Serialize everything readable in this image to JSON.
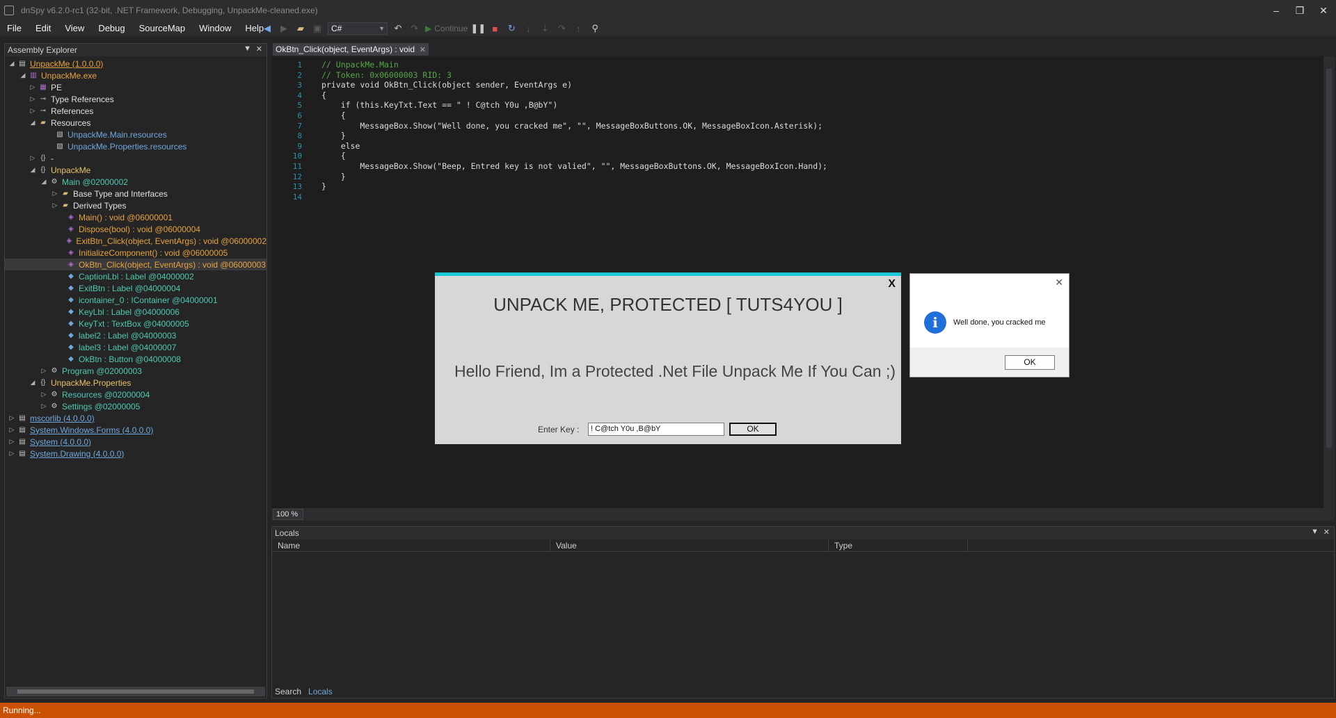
{
  "window": {
    "title": "dnSpy v6.2.0-rc1 (32-bit, .NET Framework, Debugging, UnpackMe-cleaned.exe)",
    "min": "–",
    "max": "❐",
    "close": "✕"
  },
  "menu": [
    "File",
    "Edit",
    "View",
    "Debug",
    "SourceMap",
    "Window",
    "Help"
  ],
  "toolbar": {
    "language": "C#",
    "continue_label": "Continue"
  },
  "explorer": {
    "title": "Assembly Explorer",
    "nodes": [
      {
        "text": "UnpackMe (1.0.0.0)",
        "exp": "◢",
        "icon": "assembly-icon",
        "color": "#e8a33d",
        "u": true
      },
      {
        "text": "UnpackMe.exe",
        "exp": "◢",
        "icon": "module-icon",
        "color": "#e8a33d"
      },
      {
        "text": "PE",
        "exp": "▷",
        "icon": "pe-icon",
        "color": "#e0e0e0"
      },
      {
        "text": "Type References",
        "exp": "▷",
        "icon": "type-ref-icon",
        "color": "#e0e0e0"
      },
      {
        "text": "References",
        "exp": "▷",
        "icon": "references-icon",
        "color": "#e0e0e0"
      },
      {
        "text": "Resources",
        "exp": "◢",
        "icon": "folder-open-icon",
        "color": "#e0e0e0"
      },
      {
        "text": "UnpackMe.Main.resources",
        "exp": "",
        "icon": "resource-icon",
        "color": "#6fa8dc"
      },
      {
        "text": "UnpackMe.Properties.resources",
        "exp": "",
        "icon": "resource-icon",
        "color": "#6fa8dc"
      },
      {
        "text": "-",
        "exp": "▷",
        "icon": "namespace-icon",
        "color": "#e0e0e0"
      },
      {
        "text": "UnpackMe",
        "exp": "◢",
        "icon": "namespace-icon",
        "color": "#e8c36a"
      },
      {
        "text": "Main @02000002",
        "exp": "◢",
        "icon": "class-icon",
        "color": "#4ec9b0"
      },
      {
        "text": "Base Type and Interfaces",
        "exp": "▷",
        "icon": "folder-icon",
        "color": "#e0e0e0"
      },
      {
        "text": "Derived Types",
        "exp": "▷",
        "icon": "folder-icon",
        "color": "#e0e0e0"
      },
      {
        "text": "Main() : void @06000001",
        "exp": "",
        "icon": "method-icon",
        "color": "#e8a33d"
      },
      {
        "text": "Dispose(bool) : void @06000004",
        "exp": "",
        "icon": "method-icon",
        "color": "#e8a33d"
      },
      {
        "text": "ExitBtn_Click(object, EventArgs) : void @06000002",
        "exp": "",
        "icon": "method-icon",
        "color": "#e8a33d"
      },
      {
        "text": "InitializeComponent() : void @06000005",
        "exp": "",
        "icon": "method-icon",
        "color": "#e8a33d"
      },
      {
        "text": "OkBtn_Click(object, EventArgs) : void @06000003",
        "exp": "",
        "icon": "method-icon",
        "color": "#e8a33d",
        "sel": true
      },
      {
        "text": "CaptionLbl : Label @04000002",
        "exp": "",
        "icon": "field-icon",
        "color": "#4ec9b0"
      },
      {
        "text": "ExitBtn : Label @04000004",
        "exp": "",
        "icon": "field-icon",
        "color": "#4ec9b0"
      },
      {
        "text": "icontainer_0 : IContainer @04000001",
        "exp": "",
        "icon": "field-icon",
        "color": "#4ec9b0"
      },
      {
        "text": "KeyLbl : Label @04000006",
        "exp": "",
        "icon": "field-icon",
        "color": "#4ec9b0"
      },
      {
        "text": "KeyTxt : TextBox @04000005",
        "exp": "",
        "icon": "field-icon",
        "color": "#4ec9b0"
      },
      {
        "text": "label2 : Label @04000003",
        "exp": "",
        "icon": "field-icon",
        "color": "#4ec9b0"
      },
      {
        "text": "label3 : Label @04000007",
        "exp": "",
        "icon": "field-icon",
        "color": "#4ec9b0"
      },
      {
        "text": "OkBtn : Button @04000008",
        "exp": "",
        "icon": "field-icon",
        "color": "#4ec9b0"
      },
      {
        "text": "Program @02000003",
        "exp": "▷",
        "icon": "class-icon",
        "color": "#4ec9b0"
      },
      {
        "text": "UnpackMe.Properties",
        "exp": "◢",
        "icon": "namespace-icon",
        "color": "#e8c36a"
      },
      {
        "text": "Resources @02000004",
        "exp": "▷",
        "icon": "class-icon",
        "color": "#4ec9b0"
      },
      {
        "text": "Settings @02000005",
        "exp": "▷",
        "icon": "class-icon",
        "color": "#4ec9b0"
      },
      {
        "text": "mscorlib (4.0.0.0)",
        "exp": "▷",
        "icon": "assembly-icon",
        "color": "#6fa8dc",
        "u": true
      },
      {
        "text": "System.Windows.Forms (4.0.0.0)",
        "exp": "▷",
        "icon": "assembly-icon",
        "color": "#6fa8dc",
        "u": true
      },
      {
        "text": "System (4.0.0.0)",
        "exp": "▷",
        "icon": "assembly-icon",
        "color": "#6fa8dc",
        "u": true
      },
      {
        "text": "System.Drawing (4.0.0.0)",
        "exp": "▷",
        "icon": "assembly-icon",
        "color": "#6fa8dc",
        "u": true
      }
    ]
  },
  "document": {
    "tab": "OkBtn_Click(object, EventArgs) : void",
    "line_numbers": [
      "1",
      "2",
      "3",
      "4",
      "5",
      "6",
      "7",
      "8",
      "9",
      "10",
      "11",
      "12",
      "13",
      "14"
    ],
    "lines": [
      "// UnpackMe.Main",
      "// Token: 0x06000003 RID: 3",
      "private void OkBtn_Click(object sender, EventArgs e)",
      "{",
      "    if (this.KeyTxt.Text == \" ! C@tch Y0u ,B@bY\")",
      "    {",
      "        MessageBox.Show(\"Well done, you cracked me\", \"\", MessageBoxButtons.OK, MessageBoxIcon.Asterisk);",
      "    }",
      "    else",
      "    {",
      "        MessageBox.Show(\"Beep, Entred key is not valied\", \"\", MessageBoxButtons.OK, MessageBoxIcon.Hand);",
      "    }",
      "}",
      ""
    ],
    "zoom": "100 %"
  },
  "locals": {
    "title": "Locals",
    "columns": [
      "Name",
      "Value",
      "Type"
    ]
  },
  "bottom_tabs": [
    "Search",
    "Locals"
  ],
  "status": "Running...",
  "unpackme": {
    "close": "X",
    "caption": "UNPACK ME, PROTECTED [ TUTS4YOU ]",
    "hello": "Hello Friend, Im a Protected .Net File Unpack Me If You Can ;)",
    "key_label": "Enter Key :",
    "key_value": "! C@tch Y0u ,B@bY",
    "ok": "OK"
  },
  "msgbox": {
    "message": "Well done, you cracked me",
    "ok": "OK",
    "close": "✕"
  },
  "colors": {
    "status_bar": "#ca5100",
    "accent_cyan": "#19c9d5",
    "info_blue": "#1e6fd9"
  }
}
